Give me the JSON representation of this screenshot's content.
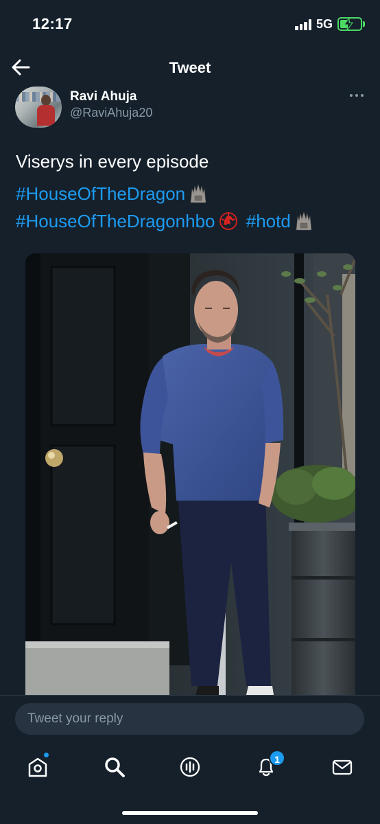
{
  "status_bar": {
    "time": "12:17",
    "network": "5G",
    "signal_bars": 4,
    "battery_level": 0.5,
    "battery_color": "#4cd964"
  },
  "header": {
    "title": "Tweet",
    "back_icon": "arrow-left-icon"
  },
  "tweet": {
    "author": {
      "name": "Ravi Ahuja",
      "handle": "@RaviAhuja20",
      "more_icon": "more-horizontal-icon"
    },
    "text": "Viserys in every episode",
    "hashtags": [
      "#HouseOfTheDragon",
      "#HouseOfTheDragonhbo",
      "#hotd"
    ],
    "emojis": [
      "iron-throne-emoji",
      "dragon-emblem-emoji",
      "iron-throne-emoji"
    ],
    "media": {
      "type": "photo",
      "subject": "man in blue sweater standing by door"
    }
  },
  "reply": {
    "placeholder": "Tweet your reply"
  },
  "bottom_nav": {
    "items": [
      {
        "icon": "home-icon",
        "has_dot": true
      },
      {
        "icon": "search-icon"
      },
      {
        "icon": "spaces-icon"
      },
      {
        "icon": "notifications-icon",
        "badge": "1"
      },
      {
        "icon": "messages-icon"
      }
    ]
  },
  "colors": {
    "background": "#15202b",
    "accent": "#1d9bf0",
    "secondary_text": "#8899a6",
    "input_background": "#273340"
  }
}
